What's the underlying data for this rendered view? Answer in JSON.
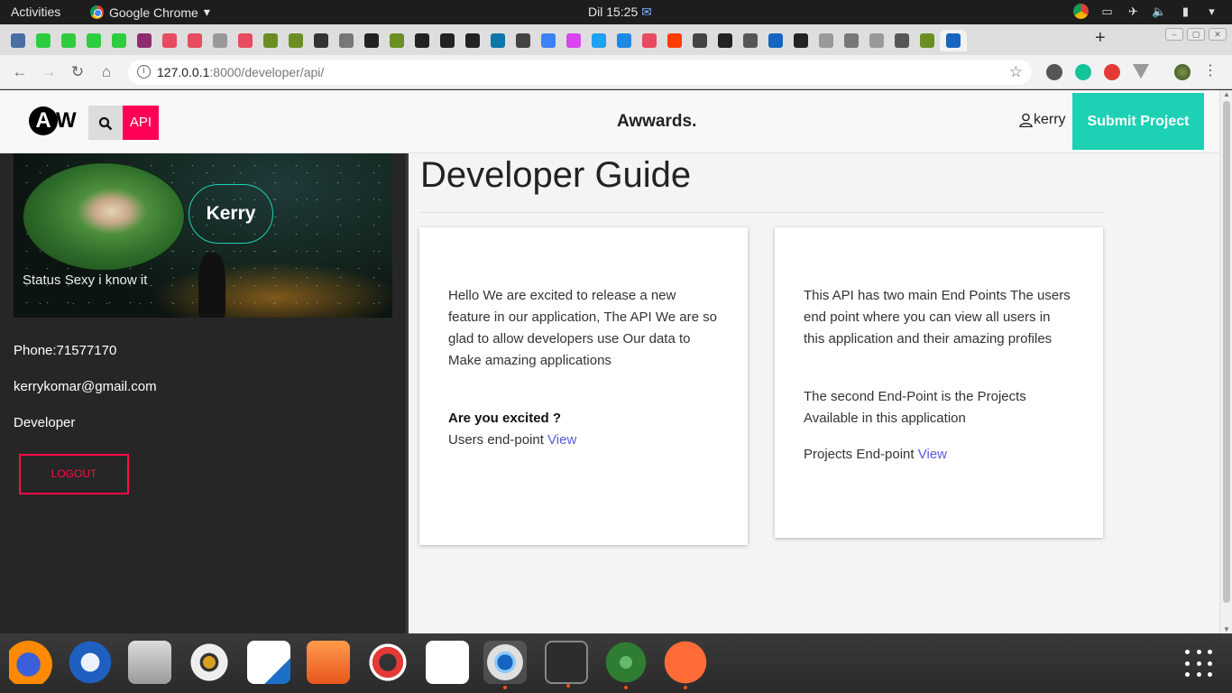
{
  "os": {
    "activities": "Activities",
    "app_name": "Google Chrome",
    "clock": "Dil 15:25"
  },
  "browser": {
    "url_host": "127.0.0.1",
    "url_path": ":8000/developer/api/"
  },
  "site": {
    "logo_a": "A",
    "logo_w": "W",
    "api_label": "API",
    "brand": "Awwards.",
    "user": "kerry",
    "submit_label": "Submit Project",
    "accent_color": "#1ed1b5",
    "brand_red": "#ff0055"
  },
  "profile": {
    "name": "Kerry",
    "status": "Status Sexy i know it",
    "phone": "Phone:71577170",
    "email": "kerrykomar@gmail.com",
    "role": "Developer",
    "logout_label": "LOGOUT"
  },
  "main": {
    "heading": "Developer Guide",
    "card1": {
      "intro": "Hello We are excited to release a new feature in our application, The API We are so glad to allow developers use Our data to Make amazing applications",
      "question": "Are you excited ?",
      "endpoint_label": "Users end-point",
      "link_label": "View"
    },
    "card2": {
      "intro": "This API has two main End Points The users end point where you can view all users in this application and their amazing profiles",
      "second": "The second End-Point is the Projects Available in this application",
      "endpoint_label": "Projects End-point",
      "link_label": "View"
    }
  }
}
